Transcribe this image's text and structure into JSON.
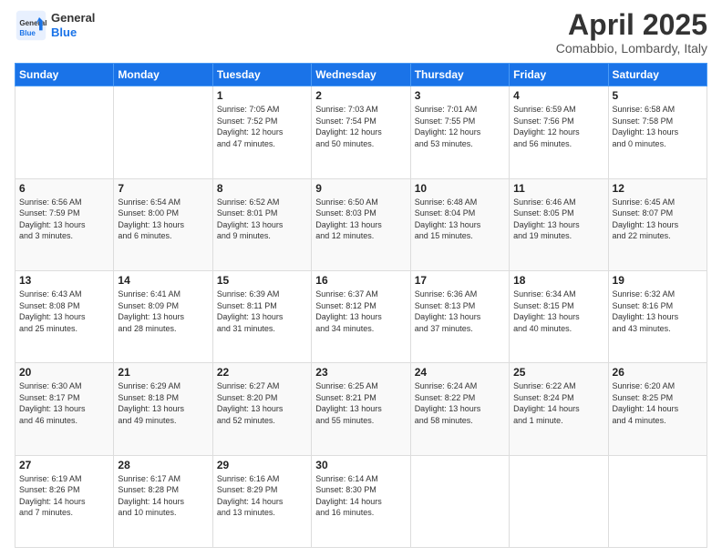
{
  "header": {
    "logo_general": "General",
    "logo_blue": "Blue",
    "month": "April 2025",
    "location": "Comabbio, Lombardy, Italy"
  },
  "weekdays": [
    "Sunday",
    "Monday",
    "Tuesday",
    "Wednesday",
    "Thursday",
    "Friday",
    "Saturday"
  ],
  "weeks": [
    [
      {
        "day": "",
        "info": ""
      },
      {
        "day": "",
        "info": ""
      },
      {
        "day": "1",
        "info": "Sunrise: 7:05 AM\nSunset: 7:52 PM\nDaylight: 12 hours\nand 47 minutes."
      },
      {
        "day": "2",
        "info": "Sunrise: 7:03 AM\nSunset: 7:54 PM\nDaylight: 12 hours\nand 50 minutes."
      },
      {
        "day": "3",
        "info": "Sunrise: 7:01 AM\nSunset: 7:55 PM\nDaylight: 12 hours\nand 53 minutes."
      },
      {
        "day": "4",
        "info": "Sunrise: 6:59 AM\nSunset: 7:56 PM\nDaylight: 12 hours\nand 56 minutes."
      },
      {
        "day": "5",
        "info": "Sunrise: 6:58 AM\nSunset: 7:58 PM\nDaylight: 13 hours\nand 0 minutes."
      }
    ],
    [
      {
        "day": "6",
        "info": "Sunrise: 6:56 AM\nSunset: 7:59 PM\nDaylight: 13 hours\nand 3 minutes."
      },
      {
        "day": "7",
        "info": "Sunrise: 6:54 AM\nSunset: 8:00 PM\nDaylight: 13 hours\nand 6 minutes."
      },
      {
        "day": "8",
        "info": "Sunrise: 6:52 AM\nSunset: 8:01 PM\nDaylight: 13 hours\nand 9 minutes."
      },
      {
        "day": "9",
        "info": "Sunrise: 6:50 AM\nSunset: 8:03 PM\nDaylight: 13 hours\nand 12 minutes."
      },
      {
        "day": "10",
        "info": "Sunrise: 6:48 AM\nSunset: 8:04 PM\nDaylight: 13 hours\nand 15 minutes."
      },
      {
        "day": "11",
        "info": "Sunrise: 6:46 AM\nSunset: 8:05 PM\nDaylight: 13 hours\nand 19 minutes."
      },
      {
        "day": "12",
        "info": "Sunrise: 6:45 AM\nSunset: 8:07 PM\nDaylight: 13 hours\nand 22 minutes."
      }
    ],
    [
      {
        "day": "13",
        "info": "Sunrise: 6:43 AM\nSunset: 8:08 PM\nDaylight: 13 hours\nand 25 minutes."
      },
      {
        "day": "14",
        "info": "Sunrise: 6:41 AM\nSunset: 8:09 PM\nDaylight: 13 hours\nand 28 minutes."
      },
      {
        "day": "15",
        "info": "Sunrise: 6:39 AM\nSunset: 8:11 PM\nDaylight: 13 hours\nand 31 minutes."
      },
      {
        "day": "16",
        "info": "Sunrise: 6:37 AM\nSunset: 8:12 PM\nDaylight: 13 hours\nand 34 minutes."
      },
      {
        "day": "17",
        "info": "Sunrise: 6:36 AM\nSunset: 8:13 PM\nDaylight: 13 hours\nand 37 minutes."
      },
      {
        "day": "18",
        "info": "Sunrise: 6:34 AM\nSunset: 8:15 PM\nDaylight: 13 hours\nand 40 minutes."
      },
      {
        "day": "19",
        "info": "Sunrise: 6:32 AM\nSunset: 8:16 PM\nDaylight: 13 hours\nand 43 minutes."
      }
    ],
    [
      {
        "day": "20",
        "info": "Sunrise: 6:30 AM\nSunset: 8:17 PM\nDaylight: 13 hours\nand 46 minutes."
      },
      {
        "day": "21",
        "info": "Sunrise: 6:29 AM\nSunset: 8:18 PM\nDaylight: 13 hours\nand 49 minutes."
      },
      {
        "day": "22",
        "info": "Sunrise: 6:27 AM\nSunset: 8:20 PM\nDaylight: 13 hours\nand 52 minutes."
      },
      {
        "day": "23",
        "info": "Sunrise: 6:25 AM\nSunset: 8:21 PM\nDaylight: 13 hours\nand 55 minutes."
      },
      {
        "day": "24",
        "info": "Sunrise: 6:24 AM\nSunset: 8:22 PM\nDaylight: 13 hours\nand 58 minutes."
      },
      {
        "day": "25",
        "info": "Sunrise: 6:22 AM\nSunset: 8:24 PM\nDaylight: 14 hours\nand 1 minute."
      },
      {
        "day": "26",
        "info": "Sunrise: 6:20 AM\nSunset: 8:25 PM\nDaylight: 14 hours\nand 4 minutes."
      }
    ],
    [
      {
        "day": "27",
        "info": "Sunrise: 6:19 AM\nSunset: 8:26 PM\nDaylight: 14 hours\nand 7 minutes."
      },
      {
        "day": "28",
        "info": "Sunrise: 6:17 AM\nSunset: 8:28 PM\nDaylight: 14 hours\nand 10 minutes."
      },
      {
        "day": "29",
        "info": "Sunrise: 6:16 AM\nSunset: 8:29 PM\nDaylight: 14 hours\nand 13 minutes."
      },
      {
        "day": "30",
        "info": "Sunrise: 6:14 AM\nSunset: 8:30 PM\nDaylight: 14 hours\nand 16 minutes."
      },
      {
        "day": "",
        "info": ""
      },
      {
        "day": "",
        "info": ""
      },
      {
        "day": "",
        "info": ""
      }
    ]
  ]
}
